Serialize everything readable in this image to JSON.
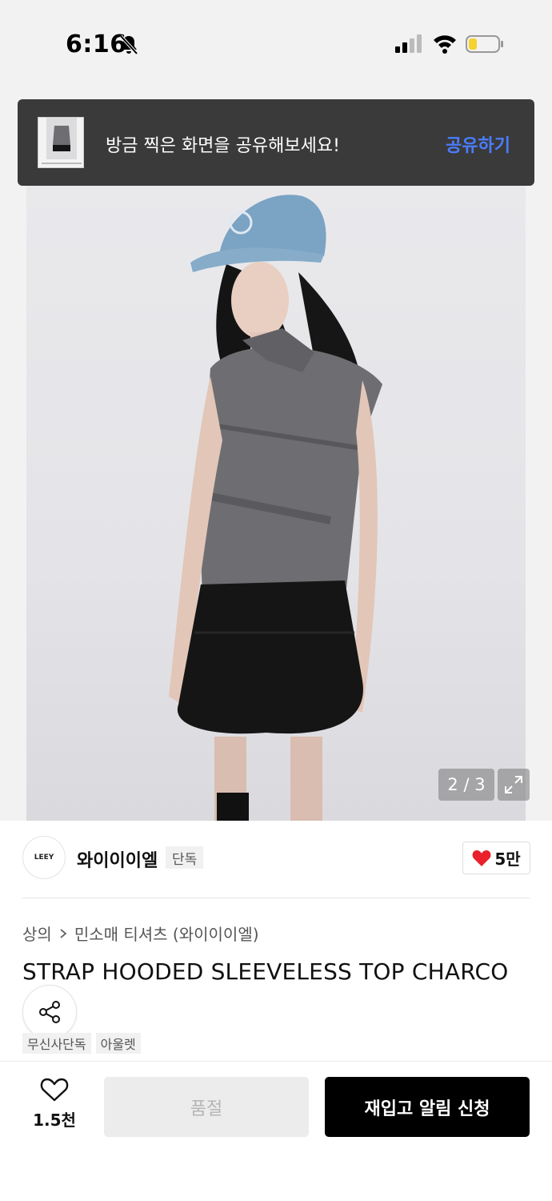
{
  "status_bar": {
    "time": "6:16"
  },
  "toast": {
    "message": "방금 찍은 화면을 공유해보세요!",
    "action": "공유하기"
  },
  "gallery": {
    "page_indicator": "2 / 3"
  },
  "brand": {
    "logo_text": "LEEY",
    "name": "와이이이엘",
    "badge": "단독",
    "likes": "5만"
  },
  "breadcrumb": {
    "category": "상의",
    "separator": ">",
    "subcategory": "민소매 티셔츠 (와이이이엘)"
  },
  "product": {
    "title": "STRAP HOODED SLEEVELESS TOP CHARCO"
  },
  "tags": [
    "무신사단독",
    "아울렛"
  ],
  "bottom_bar": {
    "wish_count": "1.5천",
    "soldout_label": "품절",
    "restock_label": "재입고 알림 신청"
  },
  "colors": {
    "accent_blue": "#4a7dff",
    "heart_red": "#e8212b",
    "toast_bg": "#3a3a3a",
    "primary_black": "#000000"
  },
  "icons": [
    "bell-muted-icon",
    "signal-icon",
    "wifi-icon",
    "battery-icon",
    "expand-icon",
    "heart-filled-icon",
    "chevron-right-icon",
    "share-icon",
    "heart-outline-icon"
  ]
}
